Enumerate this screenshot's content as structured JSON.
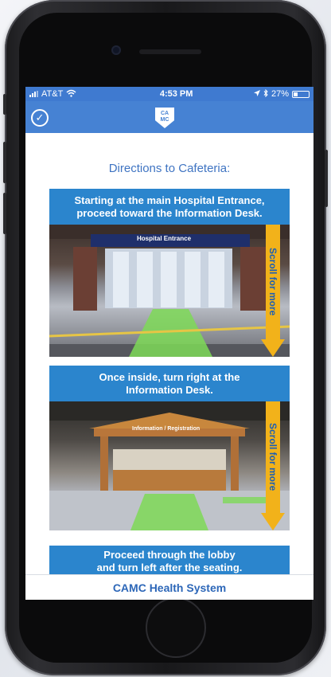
{
  "status_bar": {
    "carrier": "AT&T",
    "time": "4:53 PM",
    "battery": "27%"
  },
  "navbar": {
    "logo_text_top": "CA",
    "logo_text_bottom": "MC"
  },
  "page": {
    "title": "Directions to Cafeteria:"
  },
  "steps": [
    {
      "instruction_line1": "Starting at the main Hospital Entrance,",
      "instruction_line2": "proceed toward the Information Desk.",
      "sign_text": "Hospital Entrance",
      "scroll_hint": "Scroll for more"
    },
    {
      "instruction_line1": "Once inside, turn right at the",
      "instruction_line2": "Information Desk.",
      "sign_text": "Information / Registration",
      "scroll_hint": "Scroll for more"
    },
    {
      "instruction_line1": "Proceed through the lobby",
      "instruction_line2": "and turn left after the seating."
    }
  ],
  "footer": {
    "label": "CAMC Health System"
  },
  "colors": {
    "nav_blue": "#4682d3",
    "banner_blue": "#2b85cd",
    "arrow_yellow": "#f2b21a",
    "path_green": "#7ed957"
  }
}
